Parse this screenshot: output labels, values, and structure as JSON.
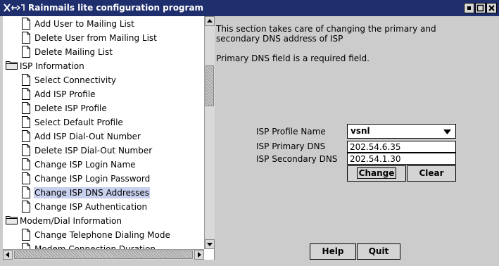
{
  "window": {
    "title": "Rainmails lite configuration program"
  },
  "tree": {
    "items": [
      {
        "label": "Add User to Mailing List",
        "type": "leaf",
        "selected": false
      },
      {
        "label": "Delete User from Mailing List",
        "type": "leaf",
        "selected": false
      },
      {
        "label": "Delete Mailing List",
        "type": "leaf",
        "selected": false
      },
      {
        "label": "ISP Information",
        "type": "folder",
        "selected": false
      },
      {
        "label": "Select Connectivity",
        "type": "leaf",
        "selected": false
      },
      {
        "label": "Add ISP Profile",
        "type": "leaf",
        "selected": false
      },
      {
        "label": "Delete ISP Profile",
        "type": "leaf",
        "selected": false
      },
      {
        "label": "Select Default Profile",
        "type": "leaf",
        "selected": false
      },
      {
        "label": "Add ISP Dial-Out Number",
        "type": "leaf",
        "selected": false
      },
      {
        "label": "Delete ISP Dial-Out Number",
        "type": "leaf",
        "selected": false
      },
      {
        "label": "Change ISP Login Name",
        "type": "leaf",
        "selected": false
      },
      {
        "label": "Change ISP Login Password",
        "type": "leaf",
        "selected": false
      },
      {
        "label": "Change ISP DNS Addresses",
        "type": "leaf",
        "selected": true
      },
      {
        "label": "Change ISP Authentication",
        "type": "leaf",
        "selected": false
      },
      {
        "label": "Modem/Dial Information",
        "type": "folder",
        "selected": false
      },
      {
        "label": "Change Telephone Dialing Mode",
        "type": "leaf",
        "selected": false
      },
      {
        "label": "Modem Connection Duration",
        "type": "leaf",
        "selected": false
      }
    ]
  },
  "content": {
    "description_line1": "This section takes care of changing the primary and",
    "description_line2": "secondary DNS address of ISP",
    "required_note": "Primary DNS field is a required field.",
    "profile_label": "ISP Profile Name",
    "profile_value": "vsnl",
    "primary_dns_label": "ISP Primary DNS",
    "primary_dns_value": "202.54.6.35",
    "secondary_dns_label": "ISP Secondary DNS",
    "secondary_dns_value": "202.54.1.30",
    "change_label": "Change",
    "clear_label": "Clear"
  },
  "footer": {
    "help_label": "Help",
    "quit_label": "Quit"
  },
  "colors": {
    "titlebar": "#1f2f6e",
    "selection": "#c8d0ee",
    "background": "#cccccc"
  }
}
